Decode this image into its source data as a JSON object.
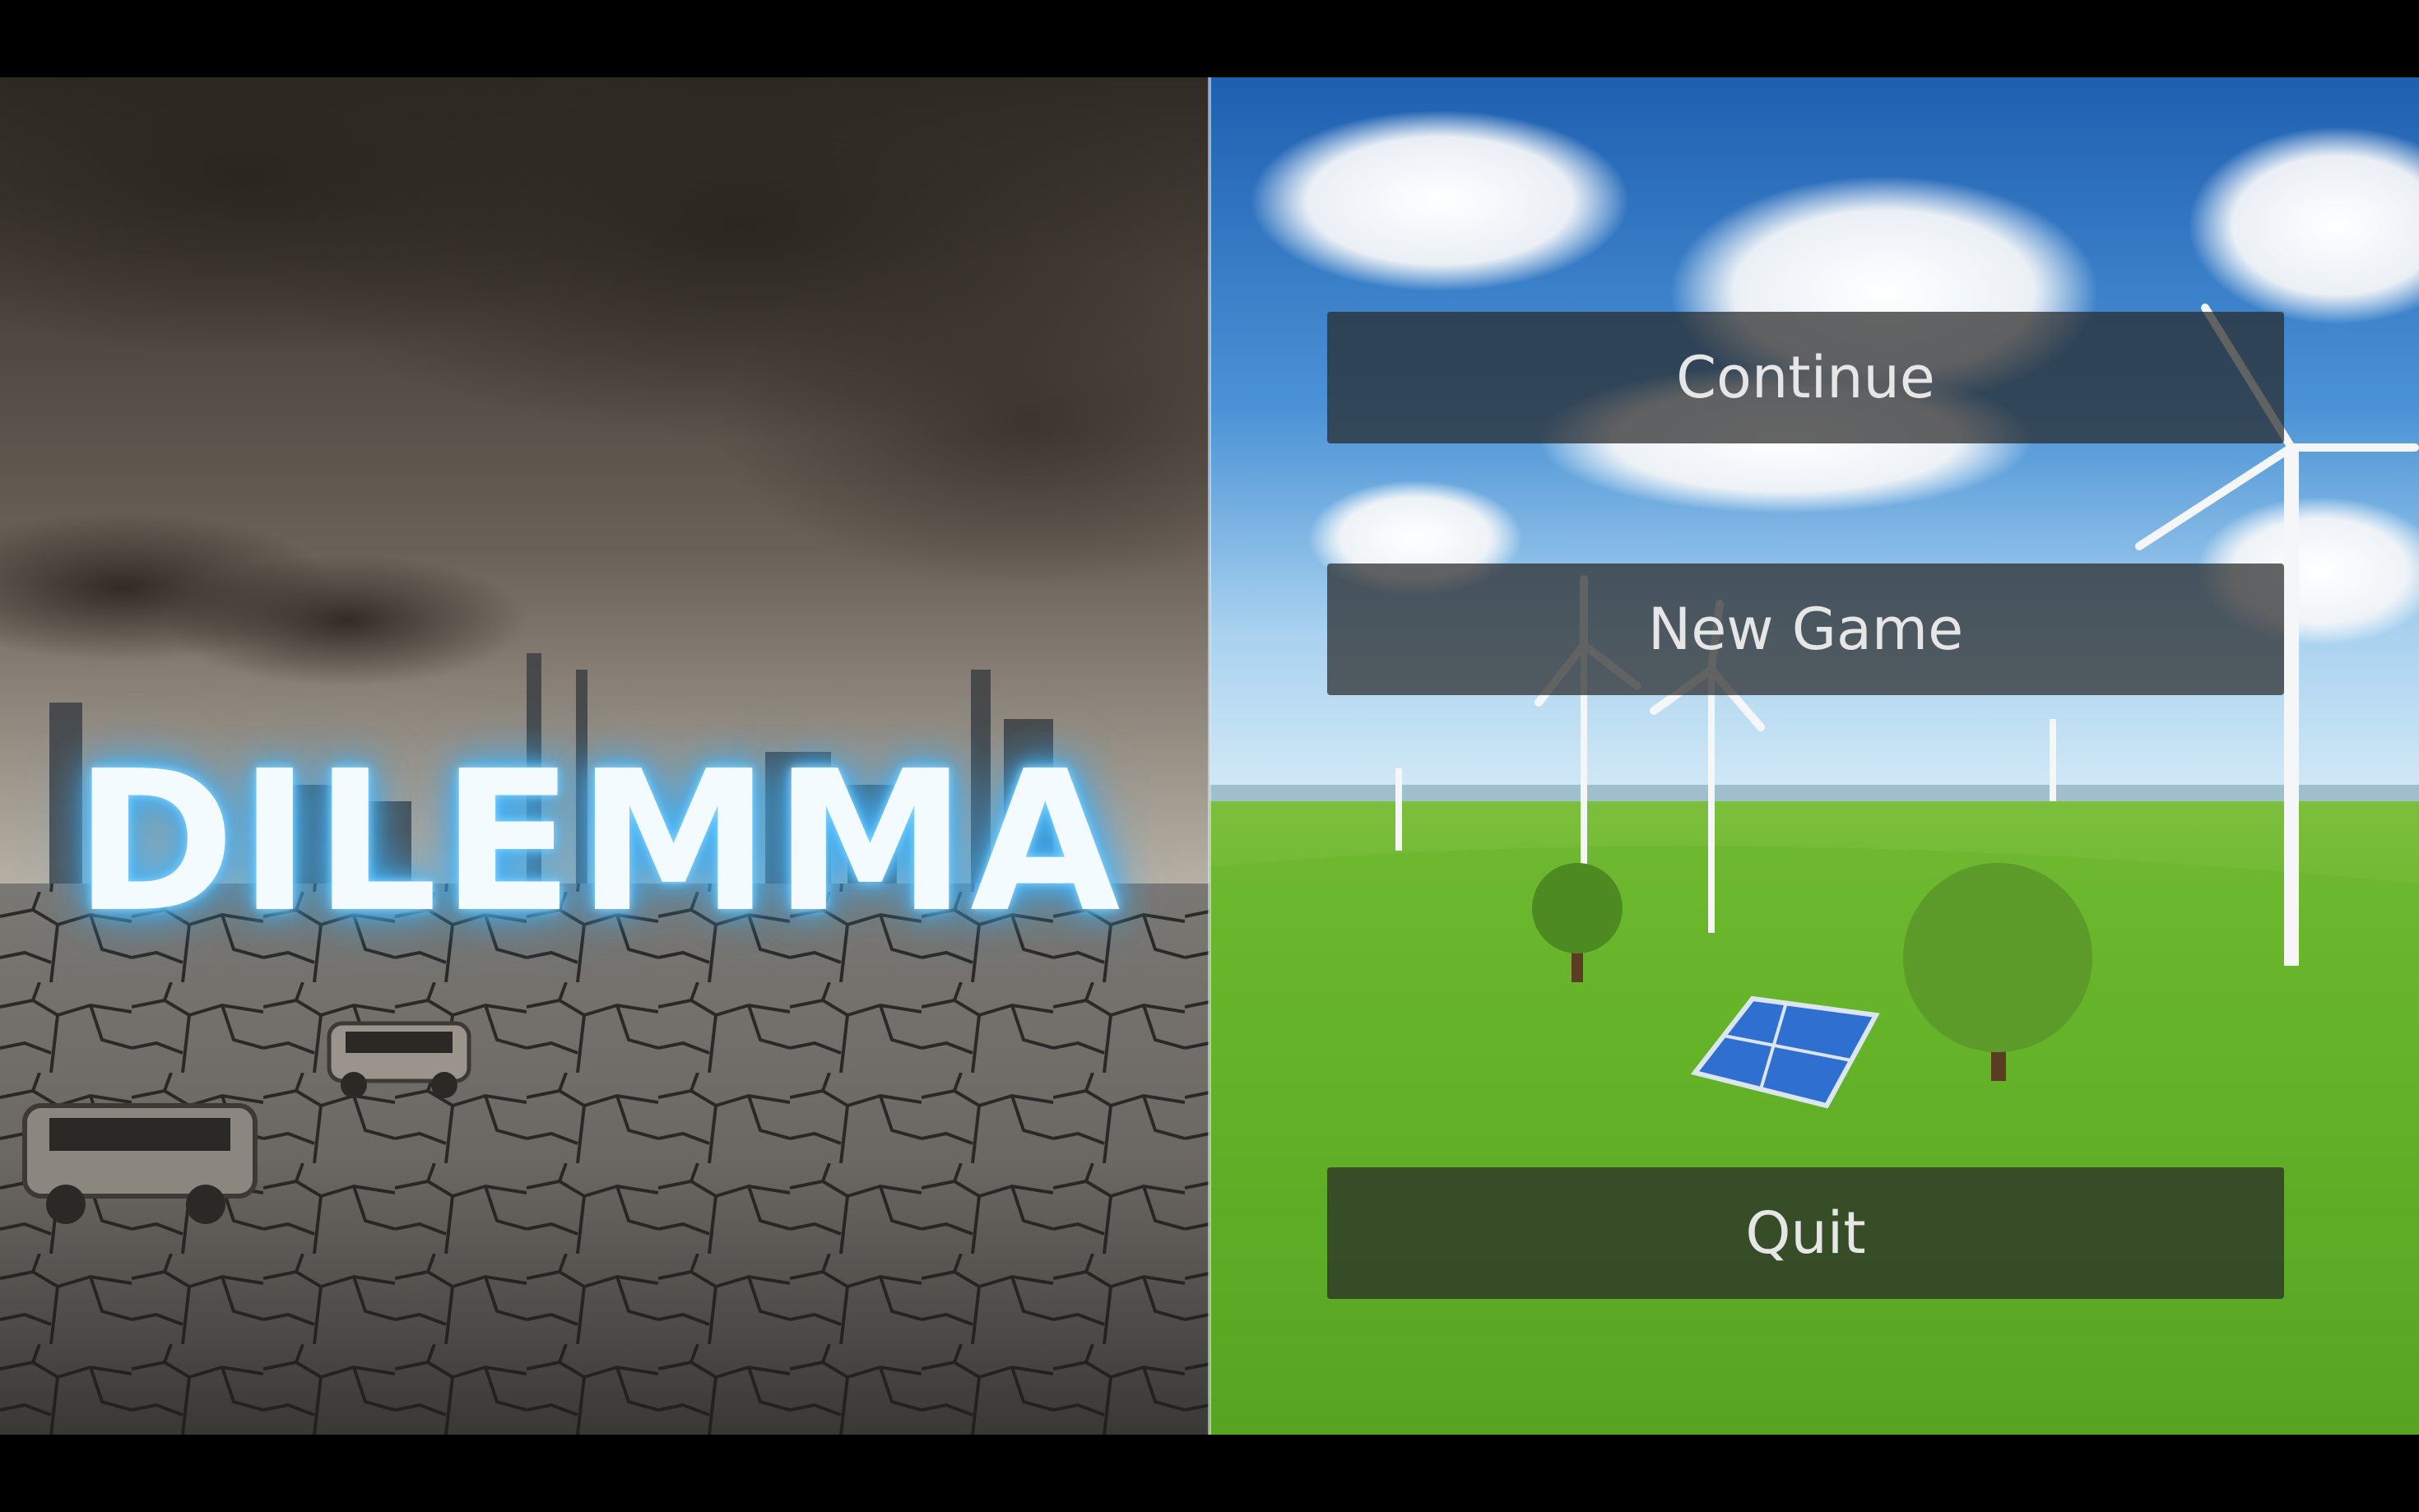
{
  "title": "DILEMMA",
  "menu": {
    "continue_label": "Continue",
    "new_game_label": "New Game",
    "quit_label": "Quit"
  },
  "colors": {
    "title_glow": "#4cbcff",
    "button_bg": "#282828",
    "button_text": "#e6e6e6"
  }
}
